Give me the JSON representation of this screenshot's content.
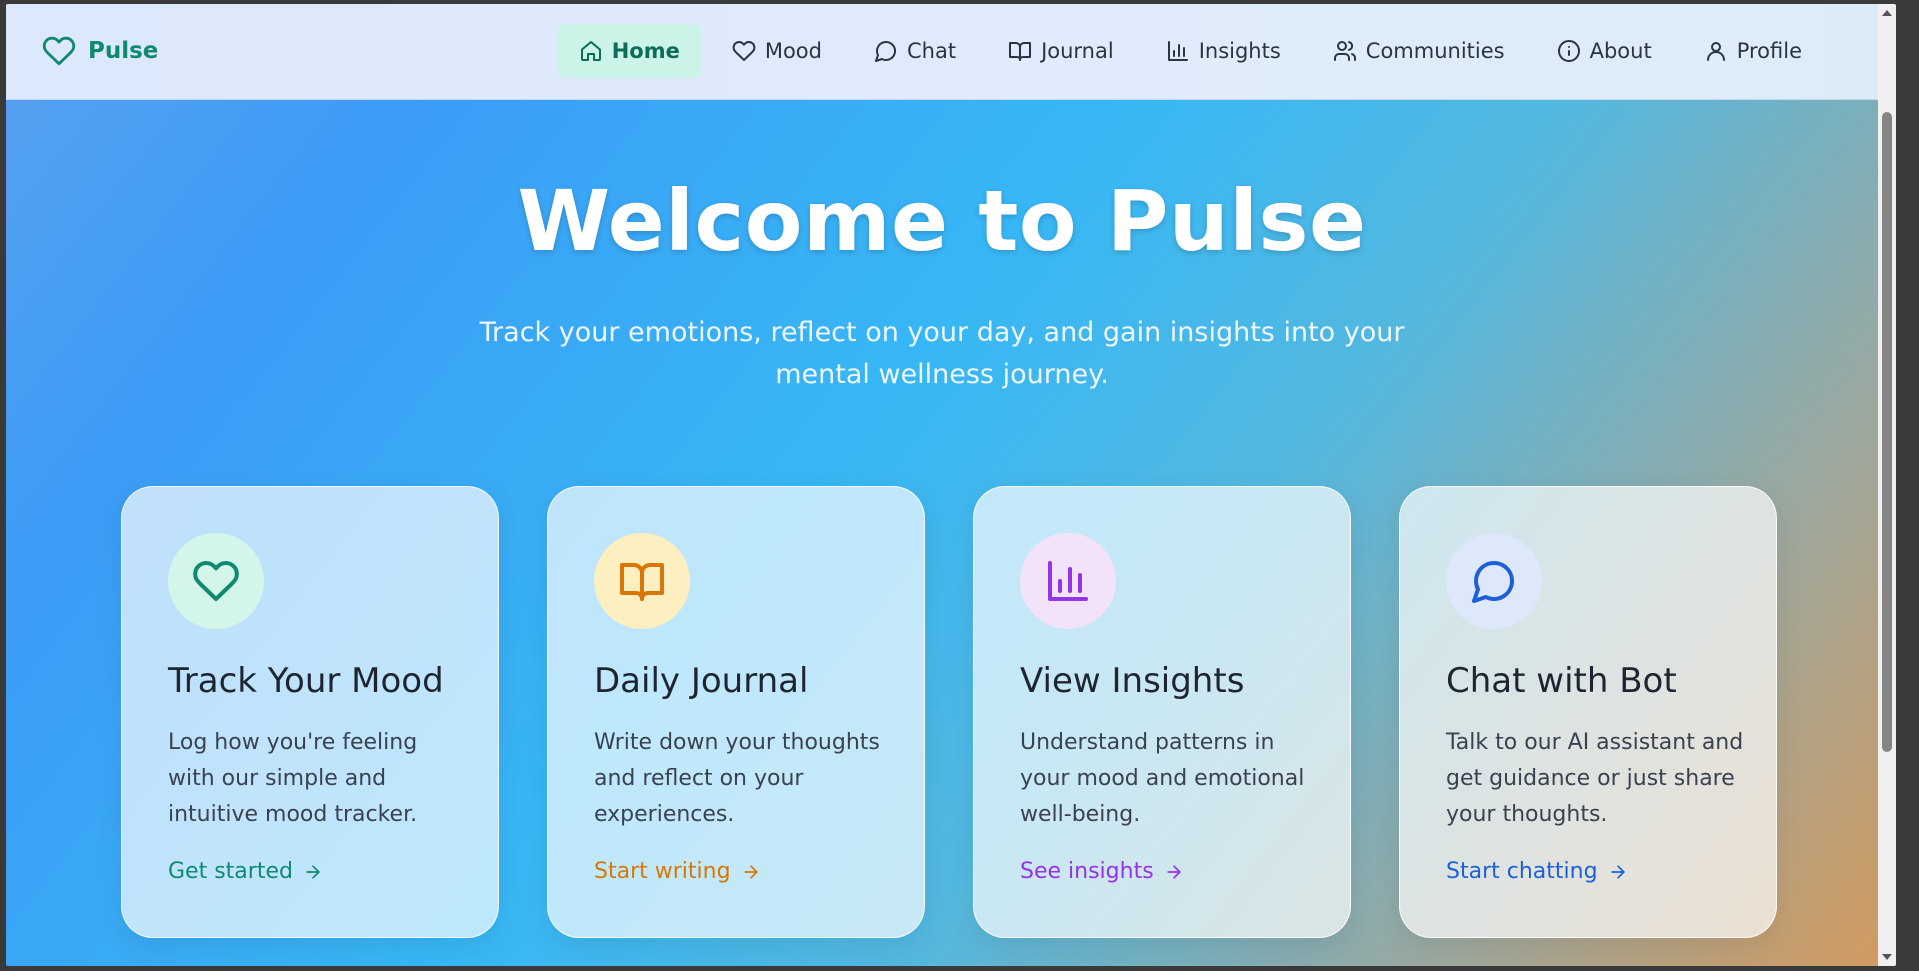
{
  "app": {
    "name": "Pulse"
  },
  "nav": {
    "items": [
      {
        "label": "Home",
        "icon": "home-icon",
        "active": true
      },
      {
        "label": "Mood",
        "icon": "heart-icon"
      },
      {
        "label": "Chat",
        "icon": "chat-bubble-icon"
      },
      {
        "label": "Journal",
        "icon": "book-icon"
      },
      {
        "label": "Insights",
        "icon": "bar-chart-icon"
      },
      {
        "label": "Communities",
        "icon": "users-icon"
      },
      {
        "label": "About",
        "icon": "info-icon"
      },
      {
        "label": "Profile",
        "icon": "user-icon"
      }
    ]
  },
  "hero": {
    "title": "Welcome to Pulse",
    "subtitle": "Track your emotions, reflect on your day, and gain insights into your mental wellness journey."
  },
  "cards": [
    {
      "title": "Track Your Mood",
      "description": "Log how you're feeling with our simple and intuitive mood tracker.",
      "link": "Get started",
      "icon": "heart-icon",
      "accent": "#0f8a6e",
      "icon_bg": "#d4f5ea"
    },
    {
      "title": "Daily Journal",
      "description": "Write down your thoughts and reflect on your experiences.",
      "link": "Start writing",
      "icon": "book-icon",
      "accent": "#d97706",
      "icon_bg": "#fdefc0"
    },
    {
      "title": "View Insights",
      "description": "Understand patterns in your mood and emotional well-being.",
      "link": "See insights",
      "icon": "bar-chart-icon",
      "accent": "#9333ea",
      "icon_bg": "#f2e3fb"
    },
    {
      "title": "Chat with Bot",
      "description": "Talk to our AI assistant and get guidance or just share your thoughts.",
      "link": "Start chatting",
      "icon": "chat-bubble-icon",
      "accent": "#1d5fd8",
      "icon_bg": "#dde8fb"
    }
  ]
}
